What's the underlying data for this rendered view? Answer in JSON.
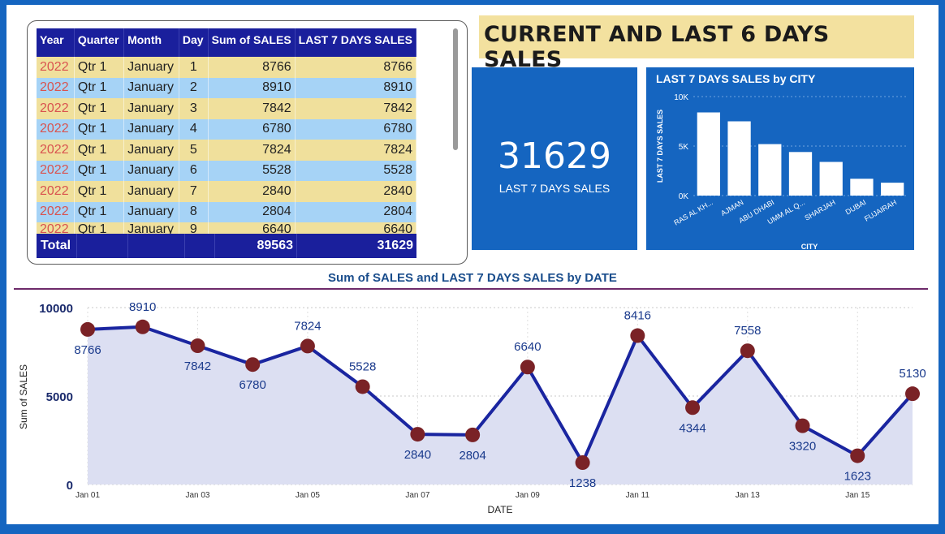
{
  "title": "CURRENT AND LAST 6 DAYS SALES",
  "table": {
    "columns": [
      "Year",
      "Quarter",
      "Month",
      "Day",
      "Sum of SALES",
      "LAST 7 DAYS SALES"
    ],
    "rows": [
      [
        "2022",
        "Qtr 1",
        "January",
        "1",
        "8766",
        "8766"
      ],
      [
        "2022",
        "Qtr 1",
        "January",
        "2",
        "8910",
        "8910"
      ],
      [
        "2022",
        "Qtr 1",
        "January",
        "3",
        "7842",
        "7842"
      ],
      [
        "2022",
        "Qtr 1",
        "January",
        "4",
        "6780",
        "6780"
      ],
      [
        "2022",
        "Qtr 1",
        "January",
        "5",
        "7824",
        "7824"
      ],
      [
        "2022",
        "Qtr 1",
        "January",
        "6",
        "5528",
        "5528"
      ],
      [
        "2022",
        "Qtr 1",
        "January",
        "7",
        "2840",
        "2840"
      ],
      [
        "2022",
        "Qtr 1",
        "January",
        "8",
        "2804",
        "2804"
      ],
      [
        "2022",
        "Qtr 1",
        "January",
        "9",
        "6640",
        "6640"
      ]
    ],
    "total_label": "Total",
    "total_sales": "89563",
    "total_last7": "31629"
  },
  "kpi": {
    "value": "31629",
    "label": "LAST 7 DAYS SALES"
  },
  "colors": {
    "frame": "#1565c0",
    "header": "#1a1f9c",
    "row_odd": "#f0e09c",
    "row_even": "#a6d3f6",
    "year_text": "#d9534f",
    "line": "#1a25a0",
    "marker": "#7a2226",
    "area": "#dcdff2",
    "title_bg": "#f3e19f"
  },
  "chart_data": [
    {
      "type": "bar",
      "title": "LAST 7 DAYS SALES by CITY",
      "xlabel": "CITY",
      "ylabel": "LAST 7 DAYS SALES",
      "categories": [
        "RAS AL KH...",
        "AJMAN",
        "ABU DHABI",
        "UMM AL Q...",
        "SHARJAH",
        "DUBAI",
        "FUJAIRAH"
      ],
      "values": [
        8400,
        7500,
        5200,
        4400,
        3400,
        1700,
        1300
      ],
      "ylim": [
        0,
        10000
      ],
      "yticks": [
        0,
        5000,
        10000
      ],
      "ytick_labels": [
        "0K",
        "5K",
        "10K"
      ]
    },
    {
      "type": "line",
      "title": "Sum of SALES and LAST 7 DAYS SALES by DATE",
      "xlabel": "DATE",
      "ylabel": "Sum of SALES",
      "x": [
        "Jan 01",
        "Jan 02",
        "Jan 03",
        "Jan 04",
        "Jan 05",
        "Jan 06",
        "Jan 07",
        "Jan 08",
        "Jan 09",
        "Jan 10",
        "Jan 11",
        "Jan 12",
        "Jan 13",
        "Jan 14",
        "Jan 15",
        "Jan 16"
      ],
      "xtick_labels": [
        "Jan 01",
        "Jan 03",
        "Jan 05",
        "Jan 07",
        "Jan 09",
        "Jan 11",
        "Jan 13",
        "Jan 15"
      ],
      "values": [
        8766,
        8910,
        7842,
        6780,
        7824,
        5528,
        2840,
        2804,
        6640,
        1238,
        8416,
        4344,
        7558,
        3320,
        1623,
        5130
      ],
      "data_labels": [
        "8766",
        "8910",
        "7842",
        "6780",
        "7824",
        "5528",
        "2840",
        "2804",
        "6640",
        "1238",
        "8416",
        "4344",
        "7558",
        "3320",
        "1623",
        "5130"
      ],
      "ylim": [
        0,
        10000
      ],
      "yticks": [
        0,
        5000,
        10000
      ],
      "ytick_labels": [
        "0",
        "5000",
        "10000"
      ],
      "grid": true
    }
  ]
}
